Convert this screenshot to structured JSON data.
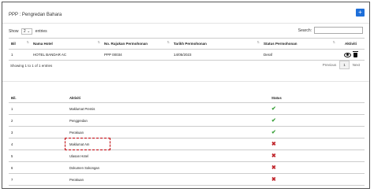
{
  "header": {
    "title": "PPP : Pengredan Bahara",
    "add_label": "+"
  },
  "controls": {
    "show_label": "Show",
    "show_value": "2",
    "entries_label": "entries",
    "search_label": "Search:"
  },
  "table1": {
    "columns": [
      "Bil",
      "Nama Hotel",
      "No. Rujukan Permohonan",
      "Tarikh Permohonan",
      "Status Permohonan",
      "Aktiviti"
    ],
    "rows": [
      {
        "bil": "1",
        "hotel": "HOTEL BANDAR AC",
        "ref": "PPP 00034",
        "date": "14/05/2023",
        "status": "Deraf"
      }
    ]
  },
  "footer": {
    "info": "Showing 1 to 1 of 1 entries",
    "prev": "Previous",
    "page": "1",
    "next": "Next"
  },
  "table2": {
    "columns": [
      "Bil.",
      "Aktiviti",
      "Status"
    ],
    "rows": [
      {
        "bil": "1",
        "aktiviti": "Maklumat Premis",
        "status": "check"
      },
      {
        "bil": "2",
        "aktiviti": "Penggredan",
        "status": "check"
      },
      {
        "bil": "3",
        "aktiviti": "Perakuan",
        "status": "check"
      },
      {
        "bil": "4",
        "aktiviti": "Maklumat Am",
        "status": "cross"
      },
      {
        "bil": "5",
        "aktiviti": "Ulasan Hotel",
        "status": "cross"
      },
      {
        "bil": "6",
        "aktiviti": "Dokumen Sokongan",
        "status": "cross"
      },
      {
        "bil": "7",
        "aktiviti": "Perakuan",
        "status": "cross"
      }
    ]
  },
  "colors": {
    "accent": "#1e6fd9",
    "check": "#3aa13a",
    "cross": "#c0272d",
    "highlight": "#c0000a"
  }
}
